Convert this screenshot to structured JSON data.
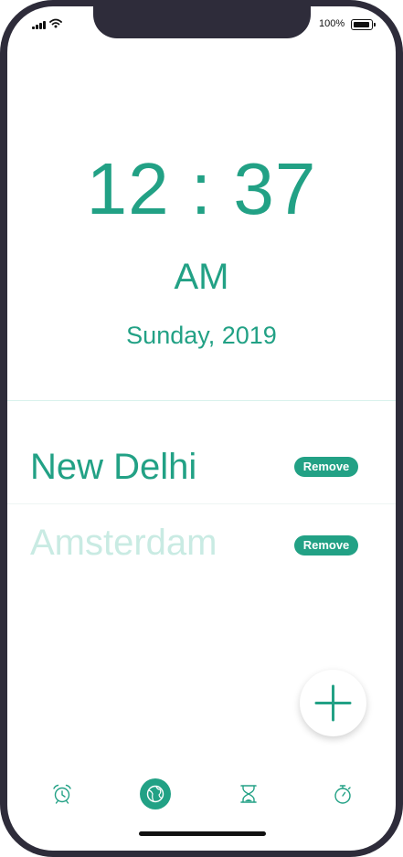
{
  "status_bar": {
    "battery_percent": "100%"
  },
  "clock": {
    "time": "12 : 37",
    "period": "AM",
    "date": "Sunday, 2019"
  },
  "cities": [
    {
      "name": "New Delhi",
      "action_label": "Remove",
      "faded": false
    },
    {
      "name": "Amsterdam",
      "action_label": "Remove",
      "faded": true
    }
  ],
  "fab": {
    "icon": "plus-icon"
  },
  "tab_bar": {
    "items": [
      {
        "icon": "alarm-clock-icon",
        "active": false
      },
      {
        "icon": "world-clock-icon",
        "active": true
      },
      {
        "icon": "hourglass-icon",
        "active": false
      },
      {
        "icon": "stopwatch-icon",
        "active": false
      }
    ]
  },
  "colors": {
    "accent": "#22a185",
    "faded_text": "#c9ebe3",
    "frame": "#2e2c3a"
  }
}
